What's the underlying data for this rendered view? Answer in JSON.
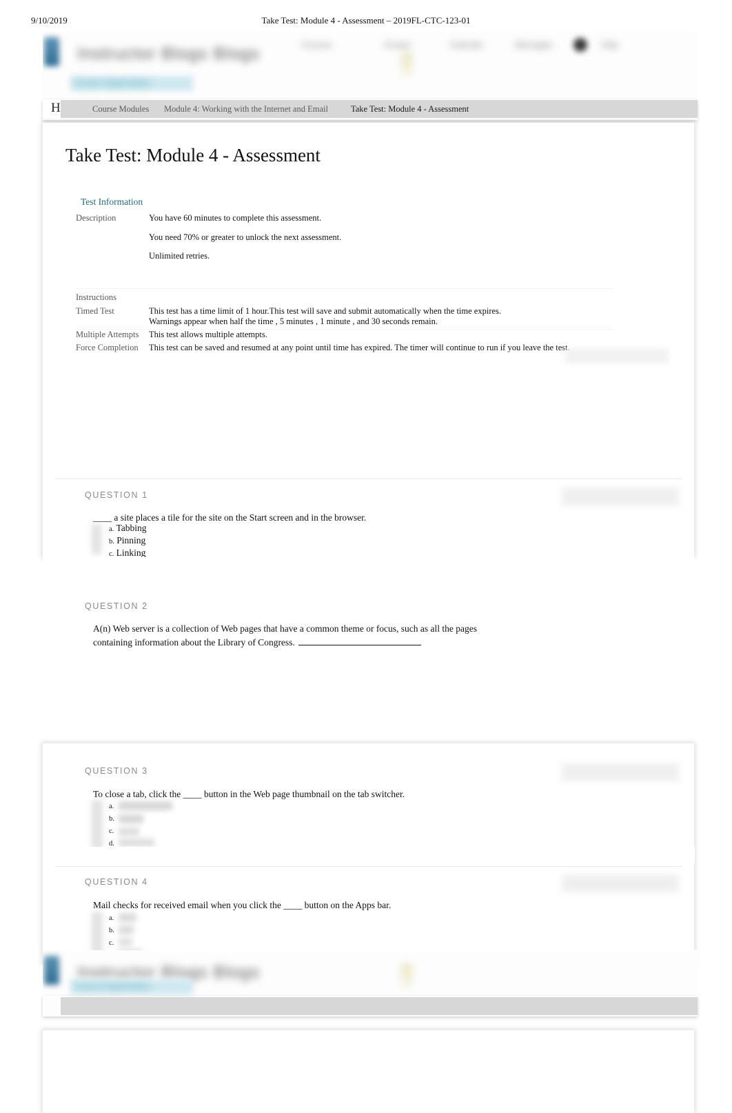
{
  "print_header": {
    "date": "9/10/2019",
    "title": "Take Test: Module 4 - Assessment – 2019FL-CTC-123-01"
  },
  "lms_chrome": {
    "brand_text_blurred": "Instructor  Blogs  Blogs",
    "nav_items_blurred": [
      "Courses",
      "Groups",
      "Calendar",
      "Messages",
      "Help"
    ],
    "cyan_band_blurred": "Course Organization",
    "avatar": "user-avatar"
  },
  "breadcrumb": {
    "home_letter": "H",
    "items": [
      {
        "label": "Course Modules",
        "current": false
      },
      {
        "label": "Module 4: Working with the Internet and Email",
        "current": false
      },
      {
        "label": "Take Test: Module 4 - Assessment",
        "current": true
      }
    ]
  },
  "page": {
    "title": "Take Test: Module 4 - Assessment",
    "section_heading": "Test Information"
  },
  "test_information": {
    "description_label": "Description",
    "description_lines": [
      "You have 60 minutes to complete this assessment.",
      "You need 70% or greater to unlock the next assessment.",
      "Unlimited retries."
    ],
    "instructions_label": "Instructions",
    "rows": [
      {
        "label": "Timed Test",
        "lines": [
          "This test has a time limit of 1 hour.This test will save and submit automatically when the time expires.",
          "Warnings appear when      half the time   , 5 minutes   , 1 minute   , and  30 seconds      remain."
        ]
      },
      {
        "label": "Multiple Attempts",
        "lines": [
          "This test allows multiple attempts."
        ]
      },
      {
        "label": "Force Completion",
        "lines": [
          "This test can be saved and resumed at any point until time has expired. The timer will continue to run if you leave the test."
        ]
      }
    ]
  },
  "questions": [
    {
      "heading": "QUESTION 1",
      "prompt": "____ a site places a tile for the site on the Start screen and in the browser.",
      "options": [
        {
          "letter": "a.",
          "text": "Tabbing",
          "legible": true
        },
        {
          "letter": "b.",
          "text": "Pinning",
          "legible": true
        },
        {
          "letter": "c.",
          "text": "Linking",
          "legible": true
        }
      ],
      "has_toolbar": true
    },
    {
      "heading": "QUESTION 2",
      "prompt": "A(n) Web server is a collection of Web pages that have a common theme or focus, such as all the pages containing information about the Library of Congress.",
      "fill_blank": true,
      "options": [],
      "has_toolbar": false
    },
    {
      "heading": "QUESTION 3",
      "prompt": "To close a tab, click the ____ button in the Web page thumbnail on the tab switcher.",
      "options": [
        {
          "letter": "a.",
          "text": "",
          "legible": false
        },
        {
          "letter": "b.",
          "text": "",
          "legible": false
        },
        {
          "letter": "c.",
          "text": "",
          "legible": false
        },
        {
          "letter": "d.",
          "text": "",
          "legible": false
        }
      ],
      "has_toolbar": true
    },
    {
      "heading": "QUESTION 4",
      "prompt": "Mail checks for received email when you click the ____ button on the Apps bar.",
      "options": [
        {
          "letter": "a.",
          "text": "",
          "legible": false
        },
        {
          "letter": "b.",
          "text": "",
          "legible": false
        },
        {
          "letter": "c.",
          "text": "",
          "legible": false
        },
        {
          "letter": "d.",
          "text": "",
          "legible": false
        }
      ],
      "has_toolbar": true
    }
  ],
  "colors": {
    "teal": "#1a6e85",
    "crumb_bar": "#d7d7d7",
    "question_label": "#8a8a8a",
    "cyan_band": "#cfe8f0"
  }
}
